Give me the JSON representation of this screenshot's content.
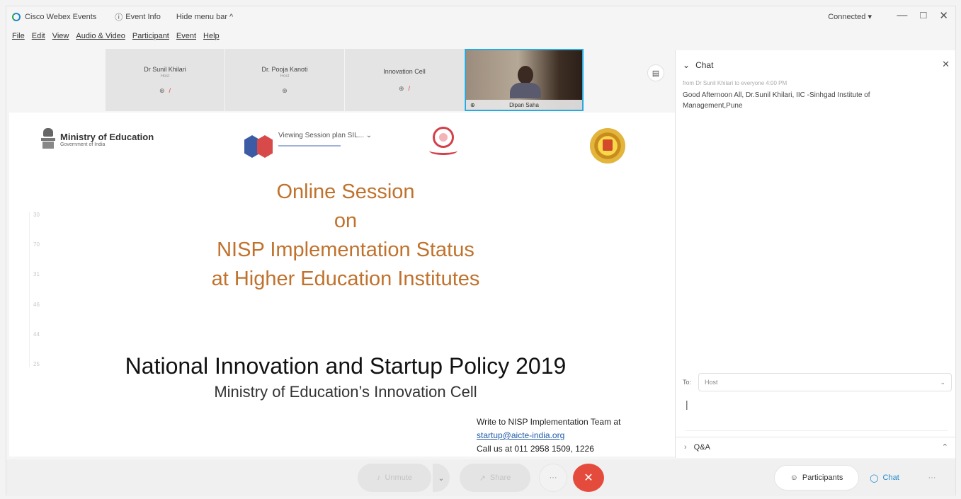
{
  "titlebar": {
    "app_name": "Cisco Webex Events",
    "event_info": "Event Info",
    "hide_menu": "Hide menu bar ^",
    "connection": "Connected ▾",
    "window_controls": [
      "—",
      "□",
      "✕"
    ]
  },
  "menubar": [
    "File",
    "Edit",
    "View",
    "Audio & Video",
    "Participant",
    "Event",
    "Help"
  ],
  "participants_strip": [
    {
      "name": "Dr Sunil Khilari",
      "sub": "Host",
      "muted": true
    },
    {
      "name": "Dr. Pooja Kanoti",
      "sub": "Host",
      "muted": false
    },
    {
      "name": "Innovation Cell",
      "sub": "",
      "muted": true
    },
    {
      "name": "Dipan Saha",
      "video": true
    }
  ],
  "slide": {
    "ministry_title": "Ministry of Education",
    "ministry_sub": "Government of India",
    "viewing": "Viewing Session plan SIL... ⌄",
    "headline": [
      "Online Session",
      "on",
      "NISP Implementation Status",
      "at Higher Education Institutes"
    ],
    "policy_title": "National Innovation and Startup Policy 2019",
    "policy_sub": "Ministry of Education’s Innovation Cell",
    "contact_line1": "Write to NISP Implementation Team at",
    "contact_email": "startup@aicte-india.org",
    "contact_phone": "Call us at 011 2958 1509, 1226",
    "side_markers": [
      "30",
      "70",
      "31",
      "46",
      "44",
      "25"
    ]
  },
  "chat": {
    "title": "Chat",
    "close": "✕",
    "meta": "from Dr Sunil Khilari to everyone   4:00 PM",
    "message": "Good Afternoon All, Dr.Sunil Khilari, IIC -Sinhgad Institute of Management,Pune",
    "to_label": "To:",
    "to_value": "Host",
    "input_value": "|",
    "qa_title": "Q&A"
  },
  "toolbar": {
    "unmute": "Unmute",
    "share": "Share",
    "more": "···",
    "leave": "✕",
    "participants": "Participants",
    "chat": "Chat",
    "menu": "···"
  }
}
